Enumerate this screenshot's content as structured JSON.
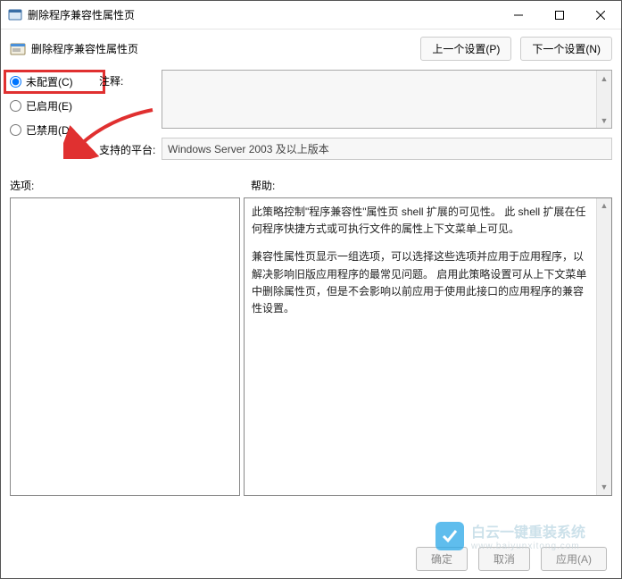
{
  "titlebar": {
    "title": "删除程序兼容性属性页"
  },
  "header": {
    "title": "删除程序兼容性属性页",
    "prev_button": "上一个设置(P)",
    "next_button": "下一个设置(N)"
  },
  "radios": {
    "not_configured": "未配置(C)",
    "enabled": "已启用(E)",
    "disabled": "已禁用(D)"
  },
  "labels": {
    "comment": "注释:",
    "supported_platforms": "支持的平台:",
    "options": "选项:",
    "help": "帮助:"
  },
  "fields": {
    "supported_platforms_value": "Windows Server 2003 及以上版本"
  },
  "help_text": {
    "p1": "此策略控制\"程序兼容性\"属性页 shell 扩展的可见性。 此 shell 扩展在任何程序快捷方式或可执行文件的属性上下文菜单上可见。",
    "p2": "兼容性属性页显示一组选项，可以选择这些选项并应用于应用程序，以解决影响旧版应用程序的最常见问题。 启用此策略设置可从上下文菜单中删除属性页，但是不会影响以前应用于使用此接口的应用程序的兼容性设置。"
  },
  "footer": {
    "ok": "确定",
    "cancel": "取消",
    "apply": "应用(A)"
  },
  "watermark": {
    "main": "白云一键重装系统",
    "sub": "www.baiyunxitong.com"
  }
}
